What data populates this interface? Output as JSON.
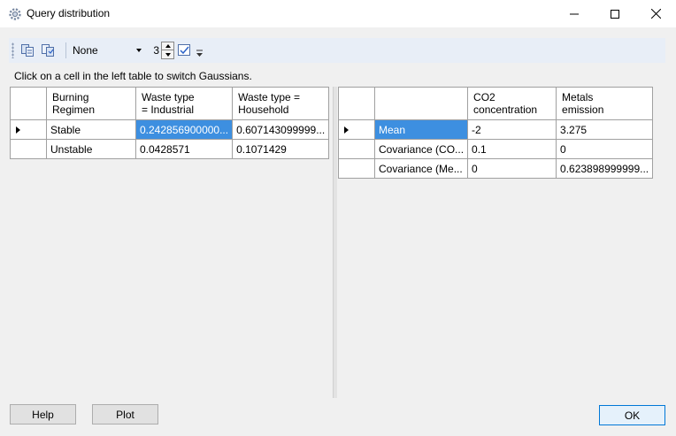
{
  "window": {
    "title": "Query distribution"
  },
  "toolbar": {
    "combo_value": "None",
    "stepper_value": "3"
  },
  "instruction": "Click on a cell in the left table to switch Gaussians.",
  "left_table": {
    "headers": [
      "Burning\nRegimen",
      "Waste type\n= Industrial",
      "Waste type =\nHousehold"
    ],
    "rows": [
      {
        "cells": [
          "Stable",
          "0.242856900000...",
          "0.607143099999..."
        ],
        "current": true
      },
      {
        "cells": [
          "Unstable",
          "0.0428571",
          "0.1071429"
        ],
        "current": false
      }
    ]
  },
  "right_table": {
    "headers": [
      "",
      "CO2\nconcentration",
      "Metals\nemission"
    ],
    "rows": [
      {
        "cells": [
          "Mean",
          "-2",
          "3.275"
        ],
        "current": true
      },
      {
        "cells": [
          "Covariance (CO...",
          "0.1",
          "0"
        ],
        "current": false
      },
      {
        "cells": [
          "Covariance (Me...",
          "0",
          "0.623898999999..."
        ],
        "current": false
      }
    ]
  },
  "buttons": {
    "help": "Help",
    "plot": "Plot",
    "ok": "OK"
  },
  "icons": {
    "app": "gear-icon",
    "copy": "copy-icon",
    "paste": "paste-icon",
    "check": "checkbox-icon"
  },
  "colors": {
    "selection": "#3d8fe0",
    "toolbar_bg": "#e8eef7",
    "ok_border": "#0078d7"
  }
}
